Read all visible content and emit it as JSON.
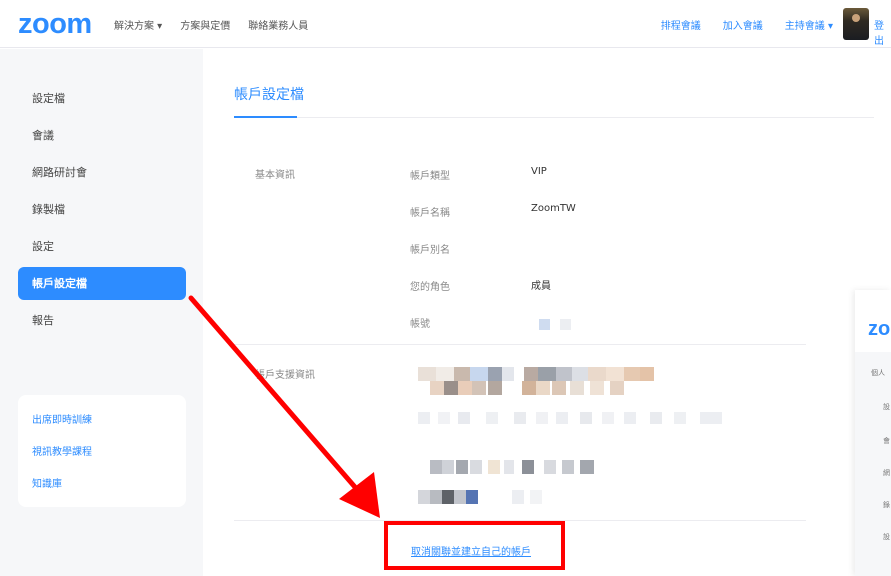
{
  "header": {
    "logo": "zoom",
    "nav_left": [
      "解決方案 ▾",
      "方案與定價",
      "聯絡業務人員"
    ],
    "nav_right": [
      "排程會議",
      "加入會議",
      "主持會議 ▾"
    ],
    "logout": "登出"
  },
  "sidebar": {
    "items": [
      {
        "label": "設定檔",
        "active": false
      },
      {
        "label": "會議",
        "active": false
      },
      {
        "label": "網路研討會",
        "active": false
      },
      {
        "label": "錄製檔",
        "active": false
      },
      {
        "label": "設定",
        "active": false
      },
      {
        "label": "帳戶設定檔",
        "active": true
      },
      {
        "label": "報告",
        "active": false
      }
    ],
    "links": [
      "出席即時訓練",
      "視訊教學課程",
      "知識庫"
    ]
  },
  "main": {
    "title": "帳戶設定檔",
    "basic_info_label": "基本資訊",
    "support_info_label": "帳戶支援資訊",
    "fields": [
      {
        "label": "帳戶類型",
        "value": "VIP"
      },
      {
        "label": "帳戶名稱",
        "value": "ZoomTW"
      },
      {
        "label": "帳戶別名",
        "value": ""
      },
      {
        "label": "您的角色",
        "value": "成員"
      },
      {
        "label": "帳號",
        "value": ""
      }
    ],
    "cancel_link": "取消關聯並建立自己的帳戶"
  },
  "overlay": {
    "logo": "zoom",
    "items": [
      "個人",
      "設",
      "會",
      "網",
      "錄",
      "設"
    ]
  },
  "colors": {
    "accent": "#2d8cff",
    "highlight": "#ff0000",
    "sidebar_bg": "#f6f7f9"
  }
}
